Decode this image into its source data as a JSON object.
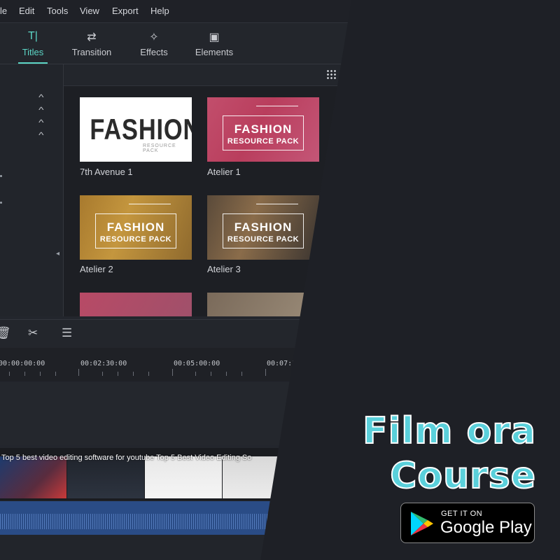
{
  "menu": [
    "le",
    "Edit",
    "Tools",
    "View",
    "Export",
    "Help"
  ],
  "tabs": [
    {
      "label": "Titles",
      "icon": "T|",
      "active": true
    },
    {
      "label": "Transition",
      "icon": "⇄",
      "active": false
    },
    {
      "label": "Effects",
      "icon": "✧",
      "active": false
    },
    {
      "label": "Elements",
      "icon": "▣",
      "active": false
    }
  ],
  "thumbnails": [
    {
      "label": "7th Avenue 1",
      "title": "FASHION",
      "subtitle": "RESOURCE PACK"
    },
    {
      "label": "Atelier 1",
      "title": "FASHION",
      "subtitle": "RESOURCE PACK"
    },
    {
      "label": "Atelier 2",
      "title": "FASHION",
      "subtitle": "RESOURCE PACK"
    },
    {
      "label": "Atelier 3",
      "title": "FASHION",
      "subtitle": "RESOURCE PACK"
    }
  ],
  "timeline": {
    "times": [
      "00:00:00:00",
      "00:02:30:00",
      "00:05:00:00",
      "00:07:3"
    ],
    "clip_title": "Top 5 best video editing software for youtube Top 5 Best Video Editing So"
  },
  "promo": {
    "line1": "Film ora",
    "line2": "Course",
    "badge_small": "GET IT ON",
    "badge_big": "Google Play"
  },
  "colors": {
    "accent": "#5cd6c6",
    "promo_text": "#5ad0db",
    "background": "#1e2026"
  }
}
